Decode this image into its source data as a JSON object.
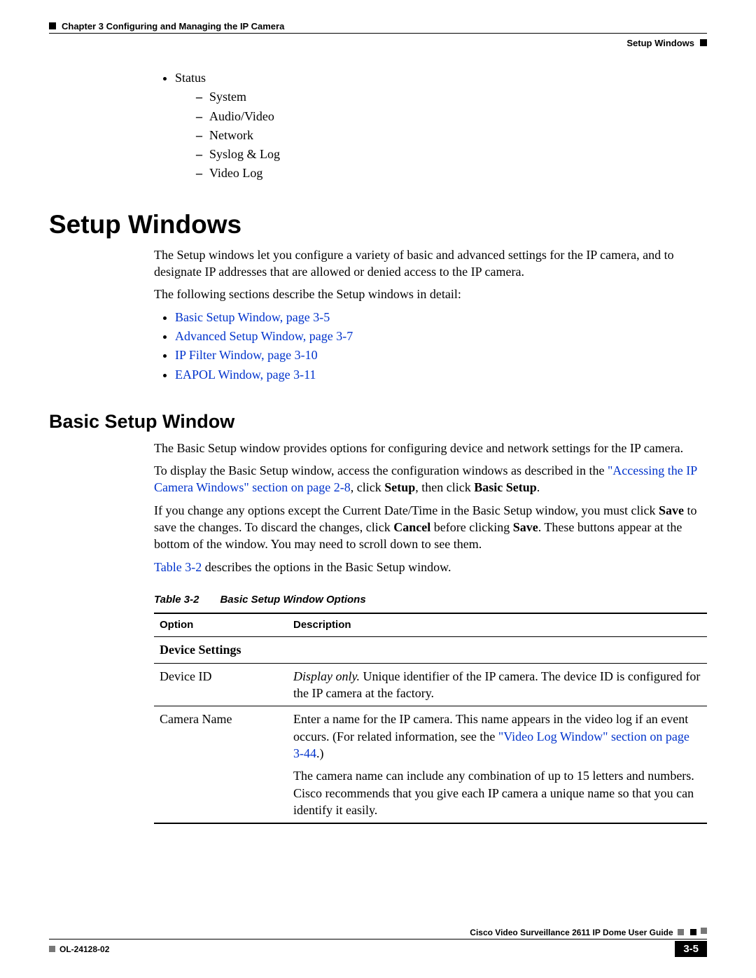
{
  "header": {
    "chapter": "Chapter 3      Configuring and Managing the IP Camera",
    "section_right": "Setup Windows"
  },
  "status_list": {
    "top": "Status",
    "items": [
      "System",
      "Audio/Video",
      "Network",
      "Syslog & Log",
      "Video Log"
    ]
  },
  "h1": "Setup Windows",
  "intro_p1": "The Setup windows let you configure a variety of basic and advanced settings for the IP camera, and to designate IP addresses that are allowed or denied access to the IP camera.",
  "intro_p2": "The following sections describe the Setup windows in detail:",
  "xrefs": [
    "Basic Setup Window, page 3-5",
    "Advanced Setup Window, page 3-7",
    "IP Filter Window, page 3-10",
    "EAPOL Window, page 3-11"
  ],
  "h2": "Basic Setup Window",
  "bsw_p1": "The Basic Setup window provides options for configuring device and network settings for the IP camera.",
  "bsw_p2a": "To display the Basic Setup window, access the configuration windows as described in the ",
  "bsw_p2_link": "\"Accessing the IP Camera Windows\" section on page 2-8",
  "bsw_p2b": ", click ",
  "bsw_p2_setup": "Setup",
  "bsw_p2c": ", then click ",
  "bsw_p2_basic": "Basic Setup",
  "bsw_p2d": ".",
  "bsw_p3a": "If you change any options except the Current Date/Time in the Basic Setup window, you must click ",
  "bsw_p3_save": "Save",
  "bsw_p3b": " to save the changes. To discard the changes, click ",
  "bsw_p3_cancel": "Cancel",
  "bsw_p3c": " before clicking ",
  "bsw_p3_save2": "Save",
  "bsw_p3d": ". These buttons appear at the bottom of the window. You may need to scroll down to see them.",
  "bsw_p4_link": "Table 3-2",
  "bsw_p4": " describes the options in the Basic Setup window.",
  "table": {
    "label": "Table 3-2",
    "title": "Basic Setup Window Options",
    "head_option": "Option",
    "head_desc": "Description",
    "group": "Device Settings",
    "row1_opt": "Device ID",
    "row1_desc_em": "Display only.",
    "row1_desc": " Unique identifier of the IP camera. The device ID is configured for the IP camera at the factory.",
    "row2_opt": "Camera Name",
    "row2_desc_a": "Enter a name for the IP camera. This name appears in the video log if an event occurs. (For related information, see the ",
    "row2_link": "\"Video Log Window\" section on page 3-44",
    "row2_desc_b": ".)",
    "row2_p2": "The camera name can include any combination of up to 15 letters and numbers. Cisco recommends that you give each IP camera a unique name so that you can identify it easily."
  },
  "footer": {
    "guide": "Cisco Video Surveillance 2611 IP Dome User Guide",
    "docnum": "OL-24128-02",
    "pagenum": "3-5"
  }
}
